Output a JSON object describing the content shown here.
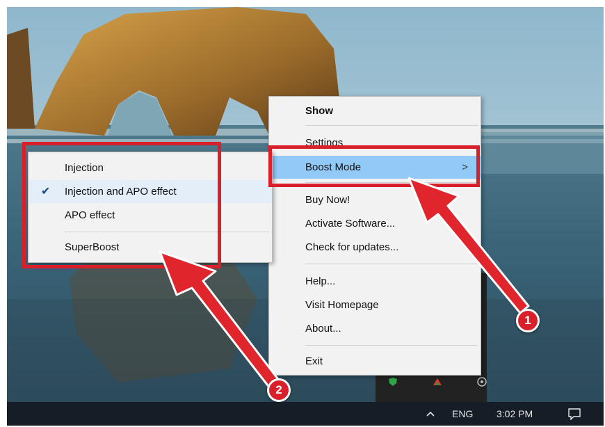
{
  "context_menu": {
    "items": [
      {
        "label": "Show"
      },
      {
        "label": "Settings"
      },
      {
        "label": "Boost Mode"
      },
      {
        "label": "Buy Now!"
      },
      {
        "label": "Activate Software..."
      },
      {
        "label": "Check for updates..."
      },
      {
        "label": "Help..."
      },
      {
        "label": "Visit Homepage"
      },
      {
        "label": "About..."
      },
      {
        "label": "Exit"
      }
    ],
    "submenu_arrow": ">"
  },
  "boost_submenu": {
    "items": [
      {
        "label": "Injection"
      },
      {
        "label": "Injection and APO effect",
        "checked": true
      },
      {
        "label": "APO effect"
      },
      {
        "label": "SuperBoost"
      }
    ],
    "check_glyph": "✔"
  },
  "annotations": {
    "badge_1": "1",
    "badge_2": "2",
    "highlight_color": "#d9202a"
  },
  "taskbar": {
    "language": "ENG",
    "time": "3:02 PM",
    "icons": [
      "chevron-up-icon",
      "notification-icon"
    ]
  },
  "colors": {
    "menu_bg": "#f2f2f2",
    "selected_bg": "#91c9f7",
    "taskbar_bg": "#151d26"
  }
}
